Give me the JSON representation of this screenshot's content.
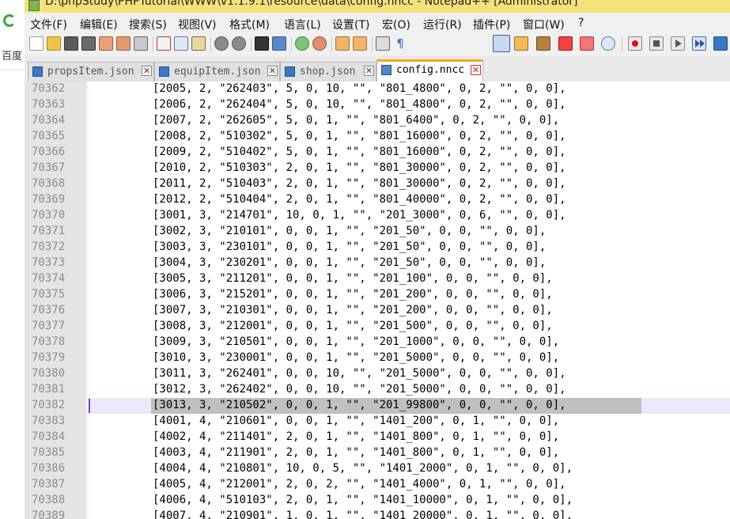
{
  "browser_left": {
    "baidu_text": "百度"
  },
  "window": {
    "title": "D:\\phpStudy\\PHPTutorial\\WWW\\v1.1.9.1\\resource\\data\\config.nncc - Notepad++ [Administrator]"
  },
  "menu": [
    "文件(F)",
    "编辑(E)",
    "搜索(S)",
    "视图(V)",
    "格式(M)",
    "语言(L)",
    "设置(T)",
    "宏(O)",
    "运行(R)",
    "插件(P)",
    "窗口(W)",
    "?"
  ],
  "tabs": [
    {
      "label": "propsItem.json",
      "active": false
    },
    {
      "label": "equipItem.json",
      "active": false
    },
    {
      "label": "shop.json",
      "active": false
    },
    {
      "label": "config.nncc",
      "active": true
    }
  ],
  "tab_close": "✕",
  "toolbar": {
    "buttons": [
      "new-icon",
      "open-icon",
      "save-icon",
      "save-all-icon",
      "close-icon",
      "close-all-icon",
      "print-icon",
      "cut-icon",
      "copy-icon",
      "paste-icon",
      "undo-icon",
      "redo-icon",
      "find-icon",
      "replace-icon",
      "zoom-in-icon",
      "zoom-out-icon",
      "sync-v-icon",
      "sync-h-icon",
      "word-wrap-icon",
      "show-all-chars-icon",
      "indent-guide-icon",
      "doc-map-icon",
      "function-list-icon",
      "folder-workspace-icon",
      "monitor-icon",
      "record-macro-icon",
      "stop-macro-icon",
      "play-macro-icon",
      "run-macro-multiple-icon",
      "save-macro-icon"
    ]
  },
  "editor": {
    "current_line": "70382",
    "lines": [
      {
        "n": "70362",
        "text": "[2005, 2, \"262403\", 5, 0, 10, \"\", \"801_4800\", 0, 2, \"\", 0, 0],"
      },
      {
        "n": "70363",
        "text": "[2006, 2, \"262404\", 5, 0, 10, \"\", \"801_4800\", 0, 2, \"\", 0, 0],"
      },
      {
        "n": "70364",
        "text": "[2007, 2, \"262605\", 5, 0, 1, \"\", \"801_6400\", 0, 2, \"\", 0, 0],"
      },
      {
        "n": "70365",
        "text": "[2008, 2, \"510302\", 5, 0, 1, \"\", \"801_16000\", 0, 2, \"\", 0, 0],"
      },
      {
        "n": "70366",
        "text": "[2009, 2, \"510402\", 5, 0, 1, \"\", \"801_16000\", 0, 2, \"\", 0, 0],"
      },
      {
        "n": "70367",
        "text": "[2010, 2, \"510303\", 2, 0, 1, \"\", \"801_30000\", 0, 2, \"\", 0, 0],"
      },
      {
        "n": "70368",
        "text": "[2011, 2, \"510403\", 2, 0, 1, \"\", \"801_30000\", 0, 2, \"\", 0, 0],"
      },
      {
        "n": "70369",
        "text": "[2012, 2, \"510404\", 2, 0, 1, \"\", \"801_40000\", 0, 2, \"\", 0, 0],"
      },
      {
        "n": "70370",
        "text": "[3001, 3, \"214701\", 10, 0, 1, \"\", \"201_3000\", 0, 6, \"\", 0, 0],"
      },
      {
        "n": "70371",
        "text": "[3002, 3, \"210101\", 0, 0, 1, \"\", \"201_50\", 0, 0, \"\", 0, 0],"
      },
      {
        "n": "70372",
        "text": "[3003, 3, \"230101\", 0, 0, 1, \"\", \"201_50\", 0, 0, \"\", 0, 0],"
      },
      {
        "n": "70373",
        "text": "[3004, 3, \"230201\", 0, 0, 1, \"\", \"201_50\", 0, 0, \"\", 0, 0],"
      },
      {
        "n": "70374",
        "text": "[3005, 3, \"211201\", 0, 0, 1, \"\", \"201_100\", 0, 0, \"\", 0, 0],"
      },
      {
        "n": "70375",
        "text": "[3006, 3, \"215201\", 0, 0, 1, \"\", \"201_200\", 0, 0, \"\", 0, 0],"
      },
      {
        "n": "70376",
        "text": "[3007, 3, \"210301\", 0, 0, 1, \"\", \"201_200\", 0, 0, \"\", 0, 0],"
      },
      {
        "n": "70377",
        "text": "[3008, 3, \"212001\", 0, 0, 1, \"\", \"201_500\", 0, 0, \"\", 0, 0],"
      },
      {
        "n": "70378",
        "text": "[3009, 3, \"210501\", 0, 0, 1, \"\", \"201_1000\", 0, 0, \"\", 0, 0],"
      },
      {
        "n": "70379",
        "text": "[3010, 3, \"230001\", 0, 0, 1, \"\", \"201_5000\", 0, 0, \"\", 0, 0],"
      },
      {
        "n": "70380",
        "text": "[3011, 3, \"262401\", 0, 0, 10, \"\", \"201_5000\", 0, 0, \"\", 0, 0],"
      },
      {
        "n": "70381",
        "text": "[3012, 3, \"262402\", 0, 0, 10, \"\", \"201_5000\", 0, 0, \"\", 0, 0],"
      },
      {
        "n": "70382",
        "text": "[3013, 3, \"210502\", 0, 0, 1, \"\", \"201_99800\", 0, 0, \"\", 0, 0],"
      },
      {
        "n": "70383",
        "text": "[4001, 4, \"210601\", 0, 0, 1, \"\", \"1401_200\", 0, 1, \"\", 0, 0],"
      },
      {
        "n": "70384",
        "text": "[4002, 4, \"211401\", 2, 0, 1, \"\", \"1401_800\", 0, 1, \"\", 0, 0],"
      },
      {
        "n": "70385",
        "text": "[4003, 4, \"211901\", 2, 0, 1, \"\", \"1401_800\", 0, 1, \"\", 0, 0],"
      },
      {
        "n": "70386",
        "text": "[4004, 4, \"210801\", 10, 0, 5, \"\", \"1401_2000\", 0, 1, \"\", 0, 0],"
      },
      {
        "n": "70387",
        "text": "[4005, 4, \"212001\", 2, 0, 2, \"\", \"1401_4000\", 0, 1, \"\", 0, 0],"
      },
      {
        "n": "70388",
        "text": "[4006, 4, \"510103\", 2, 0, 1, \"\", \"1401_10000\", 0, 1, \"\", 0, 0],"
      },
      {
        "n": "70389",
        "text": "[4007, 4, \"210901\", 1, 0, 1, \"\", \"1401_20000\", 0, 1, \"\", 0, 0],"
      }
    ]
  }
}
